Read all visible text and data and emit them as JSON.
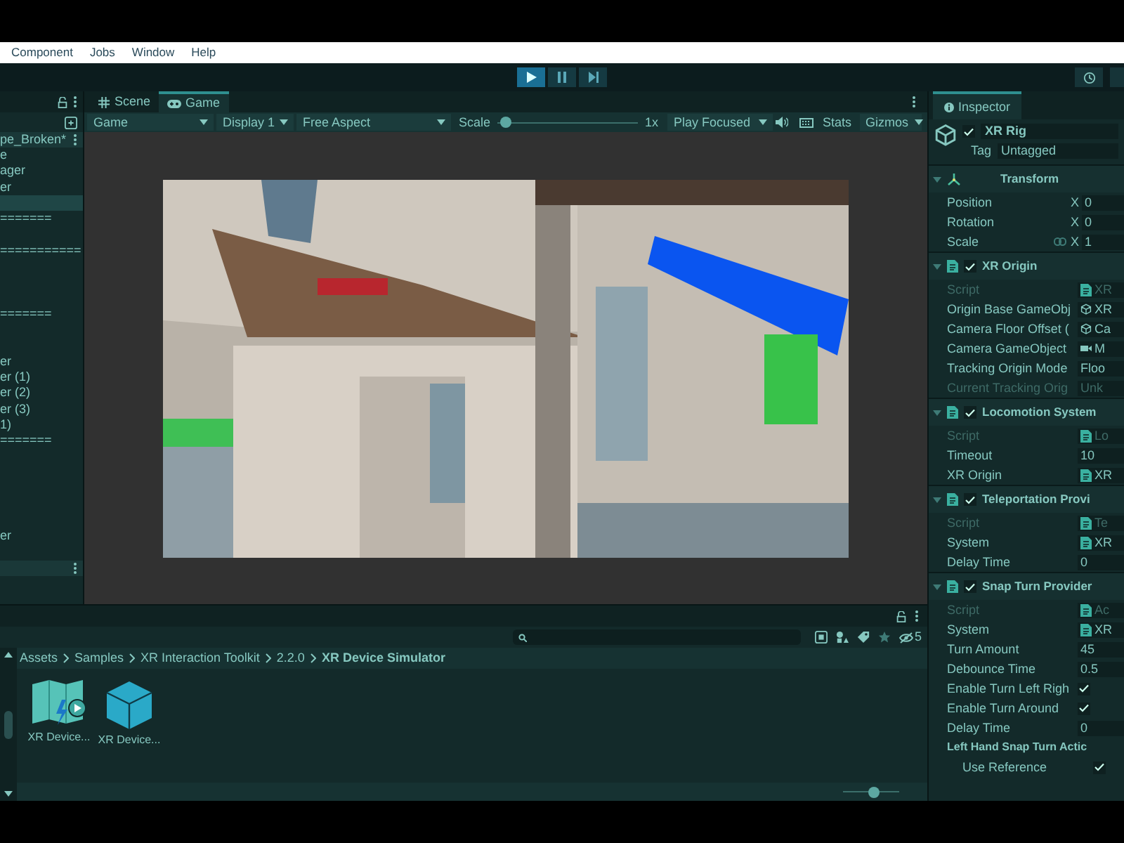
{
  "menu": [
    {
      "label": "Component"
    },
    {
      "label": "Jobs"
    },
    {
      "label": "Window"
    },
    {
      "label": "Help"
    }
  ],
  "play_controls": [
    {
      "kind": "play",
      "on": true
    },
    {
      "kind": "pause",
      "on": false
    },
    {
      "kind": "step",
      "on": false
    }
  ],
  "hierarchy": {
    "scene": "pe_Broken*",
    "items": [
      {
        "label": "e",
        "selected": false
      },
      {
        "label": "ager",
        "selected": false
      },
      {
        "label": "er",
        "selected": false
      },
      {
        "selected": true
      },
      {
        "label": "=======",
        "selected": false
      },
      {
        "selected": false
      },
      {
        "label": "===========",
        "selected": false
      },
      {
        "selected": false
      },
      {
        "selected": false
      },
      {
        "selected": false
      },
      {
        "label": "=======",
        "selected": false
      },
      {
        "selected": false
      },
      {
        "selected": false
      },
      {
        "label": "er",
        "selected": false
      },
      {
        "label": "er (1)",
        "selected": false
      },
      {
        "label": "er (2)",
        "selected": false
      },
      {
        "label": "er (3)",
        "selected": false
      },
      {
        "label": "1)",
        "selected": false
      },
      {
        "label": "=======",
        "selected": false
      },
      {
        "selected": false
      },
      {
        "selected": false
      },
      {
        "selected": false
      },
      {
        "selected": false
      },
      {
        "selected": false
      },
      {
        "label": "er",
        "selected": false
      }
    ]
  },
  "view_tabs": [
    {
      "label": "Scene",
      "kind": "scene",
      "selected": false
    },
    {
      "label": "Game",
      "kind": "game",
      "selected": true
    }
  ],
  "game_toolbar": {
    "view": "Game",
    "display": "Display 1",
    "aspect": "Free Aspect",
    "scale_label": "Scale",
    "scale": {
      "level": 0.02
    },
    "scale_value": "1x",
    "play_mode": "Play Focused",
    "stats": "Stats",
    "gizmos": "Gizmos"
  },
  "project": {
    "breadcrumb": [
      "Assets",
      "Samples",
      "XR Interaction Toolkit",
      "2.2.0",
      "XR Device Simulator"
    ],
    "hidden_count": "5",
    "assets": [
      {
        "label": "XR Device...",
        "kind": "scene"
      },
      {
        "label": "XR Device...",
        "kind": "prefab"
      }
    ],
    "zoom": {
      "level": 0.55
    }
  },
  "inspector": {
    "title": "Inspector",
    "object": {
      "name": "XR Rig",
      "active": true,
      "tag_label": "Tag",
      "tag": "Untagged"
    },
    "components": [
      {
        "kind": "transform",
        "title": "Transform",
        "expanded": true,
        "fields": [
          {
            "kind": "vector",
            "label": "Position",
            "axis": "X",
            "value": "0"
          },
          {
            "kind": "vector",
            "label": "Rotation",
            "axis": "X",
            "value": "0"
          },
          {
            "kind": "vector",
            "label": "Scale",
            "axis": "X",
            "value": "1",
            "linked": true
          }
        ]
      },
      {
        "kind": "script",
        "title": "XR Origin",
        "enabled": true,
        "expanded": true,
        "fields": [
          {
            "kind": "script",
            "label": "Script",
            "value": "XR",
            "disabled": true
          },
          {
            "kind": "object",
            "label": "Origin Base GameObj",
            "value": "XR",
            "disabled": false
          },
          {
            "kind": "object",
            "label": "Camera Floor Offset (",
            "value": "Ca",
            "disabled": false
          },
          {
            "kind": "camera",
            "label": "Camera GameObject",
            "value": "M",
            "disabled": false
          },
          {
            "kind": "text",
            "label": "Tracking Origin Mode",
            "value": "Floo",
            "disabled": false
          },
          {
            "kind": "text",
            "label": "Current Tracking Orig",
            "value": "Unk",
            "disabled": true
          }
        ]
      },
      {
        "kind": "script",
        "title": "Locomotion System",
        "enabled": true,
        "expanded": true,
        "fields": [
          {
            "kind": "script",
            "label": "Script",
            "value": "Lo",
            "disabled": true
          },
          {
            "kind": "text",
            "label": "Timeout",
            "value": "10",
            "disabled": false
          },
          {
            "kind": "script",
            "label": "XR Origin",
            "value": "XR",
            "disabled": false
          }
        ]
      },
      {
        "kind": "script",
        "title": "Teleportation Provi",
        "enabled": true,
        "expanded": true,
        "fields": [
          {
            "kind": "script",
            "label": "Script",
            "value": "Te",
            "disabled": true
          },
          {
            "kind": "script",
            "label": "System",
            "value": "XR",
            "disabled": false
          },
          {
            "kind": "text",
            "label": "Delay Time",
            "value": "0",
            "disabled": false
          }
        ]
      },
      {
        "kind": "script",
        "title": "Snap Turn Provider",
        "enabled": true,
        "expanded": true,
        "fields": [
          {
            "kind": "script",
            "label": "Script",
            "value": "Ac",
            "disabled": true
          },
          {
            "kind": "script",
            "label": "System",
            "value": "XR",
            "disabled": false
          },
          {
            "kind": "text",
            "label": "Turn Amount",
            "value": "45",
            "disabled": false
          },
          {
            "kind": "text",
            "label": "Debounce Time",
            "value": "0.5",
            "disabled": false
          },
          {
            "kind": "check",
            "label": "Enable Turn Left Righ",
            "checked": true
          },
          {
            "kind": "check",
            "label": "Enable Turn Around",
            "checked": true
          },
          {
            "kind": "text",
            "label": "Delay Time",
            "value": "0",
            "disabled": false
          },
          {
            "kind": "header",
            "label": "Left Hand Snap Turn Actic"
          },
          {
            "kind": "sub_check",
            "label": "Use Reference",
            "checked": true
          }
        ]
      }
    ]
  }
}
